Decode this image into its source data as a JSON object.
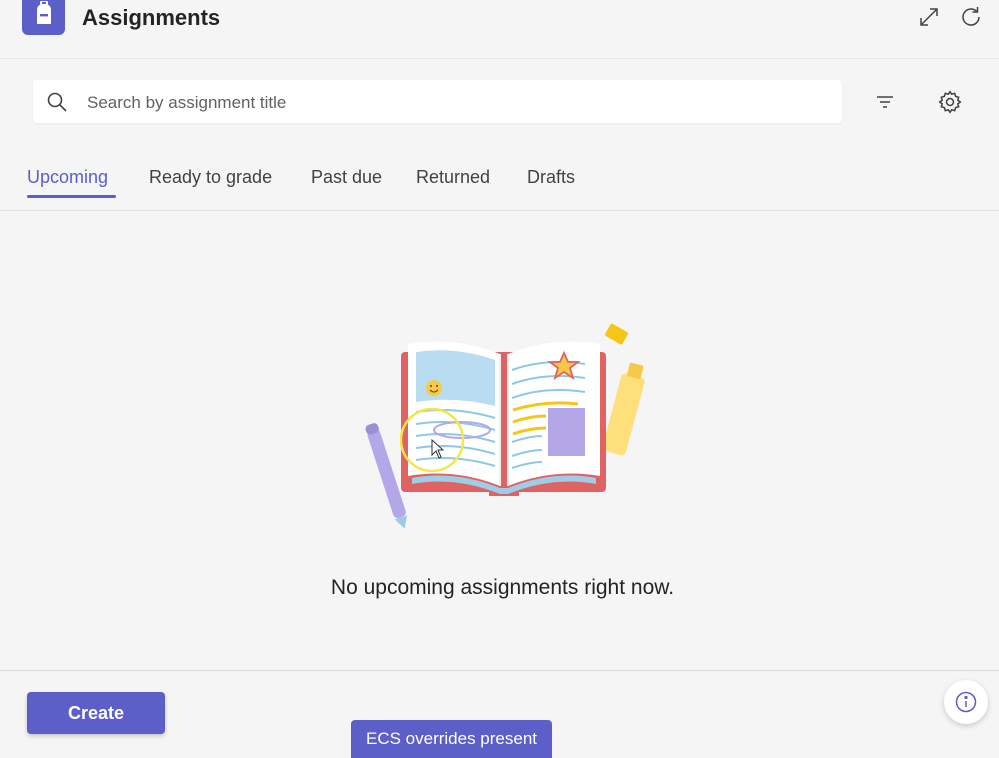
{
  "app": {
    "title": "Assignments"
  },
  "header": {
    "expand_icon": "expand-icon",
    "refresh_icon": "refresh-icon"
  },
  "search": {
    "placeholder": "Search by assignment title",
    "value": "",
    "icon": "search-icon"
  },
  "toolbar": {
    "filter_icon": "filter-icon",
    "settings_icon": "gear-icon"
  },
  "tabs": [
    {
      "label": "Upcoming",
      "active": true
    },
    {
      "label": "Ready to grade",
      "active": false
    },
    {
      "label": "Past due",
      "active": false
    },
    {
      "label": "Returned",
      "active": false
    },
    {
      "label": "Drafts",
      "active": false
    }
  ],
  "empty_state": {
    "illustration": "open-book-illustration",
    "message": "No upcoming assignments right now."
  },
  "footer": {
    "create_label": "Create",
    "info_icon": "info-icon"
  },
  "overlay": {
    "ecs_label": "ECS overrides present"
  },
  "colors": {
    "accent": "#5b5fc7",
    "background": "#f5f5f5",
    "text": "#242424"
  }
}
